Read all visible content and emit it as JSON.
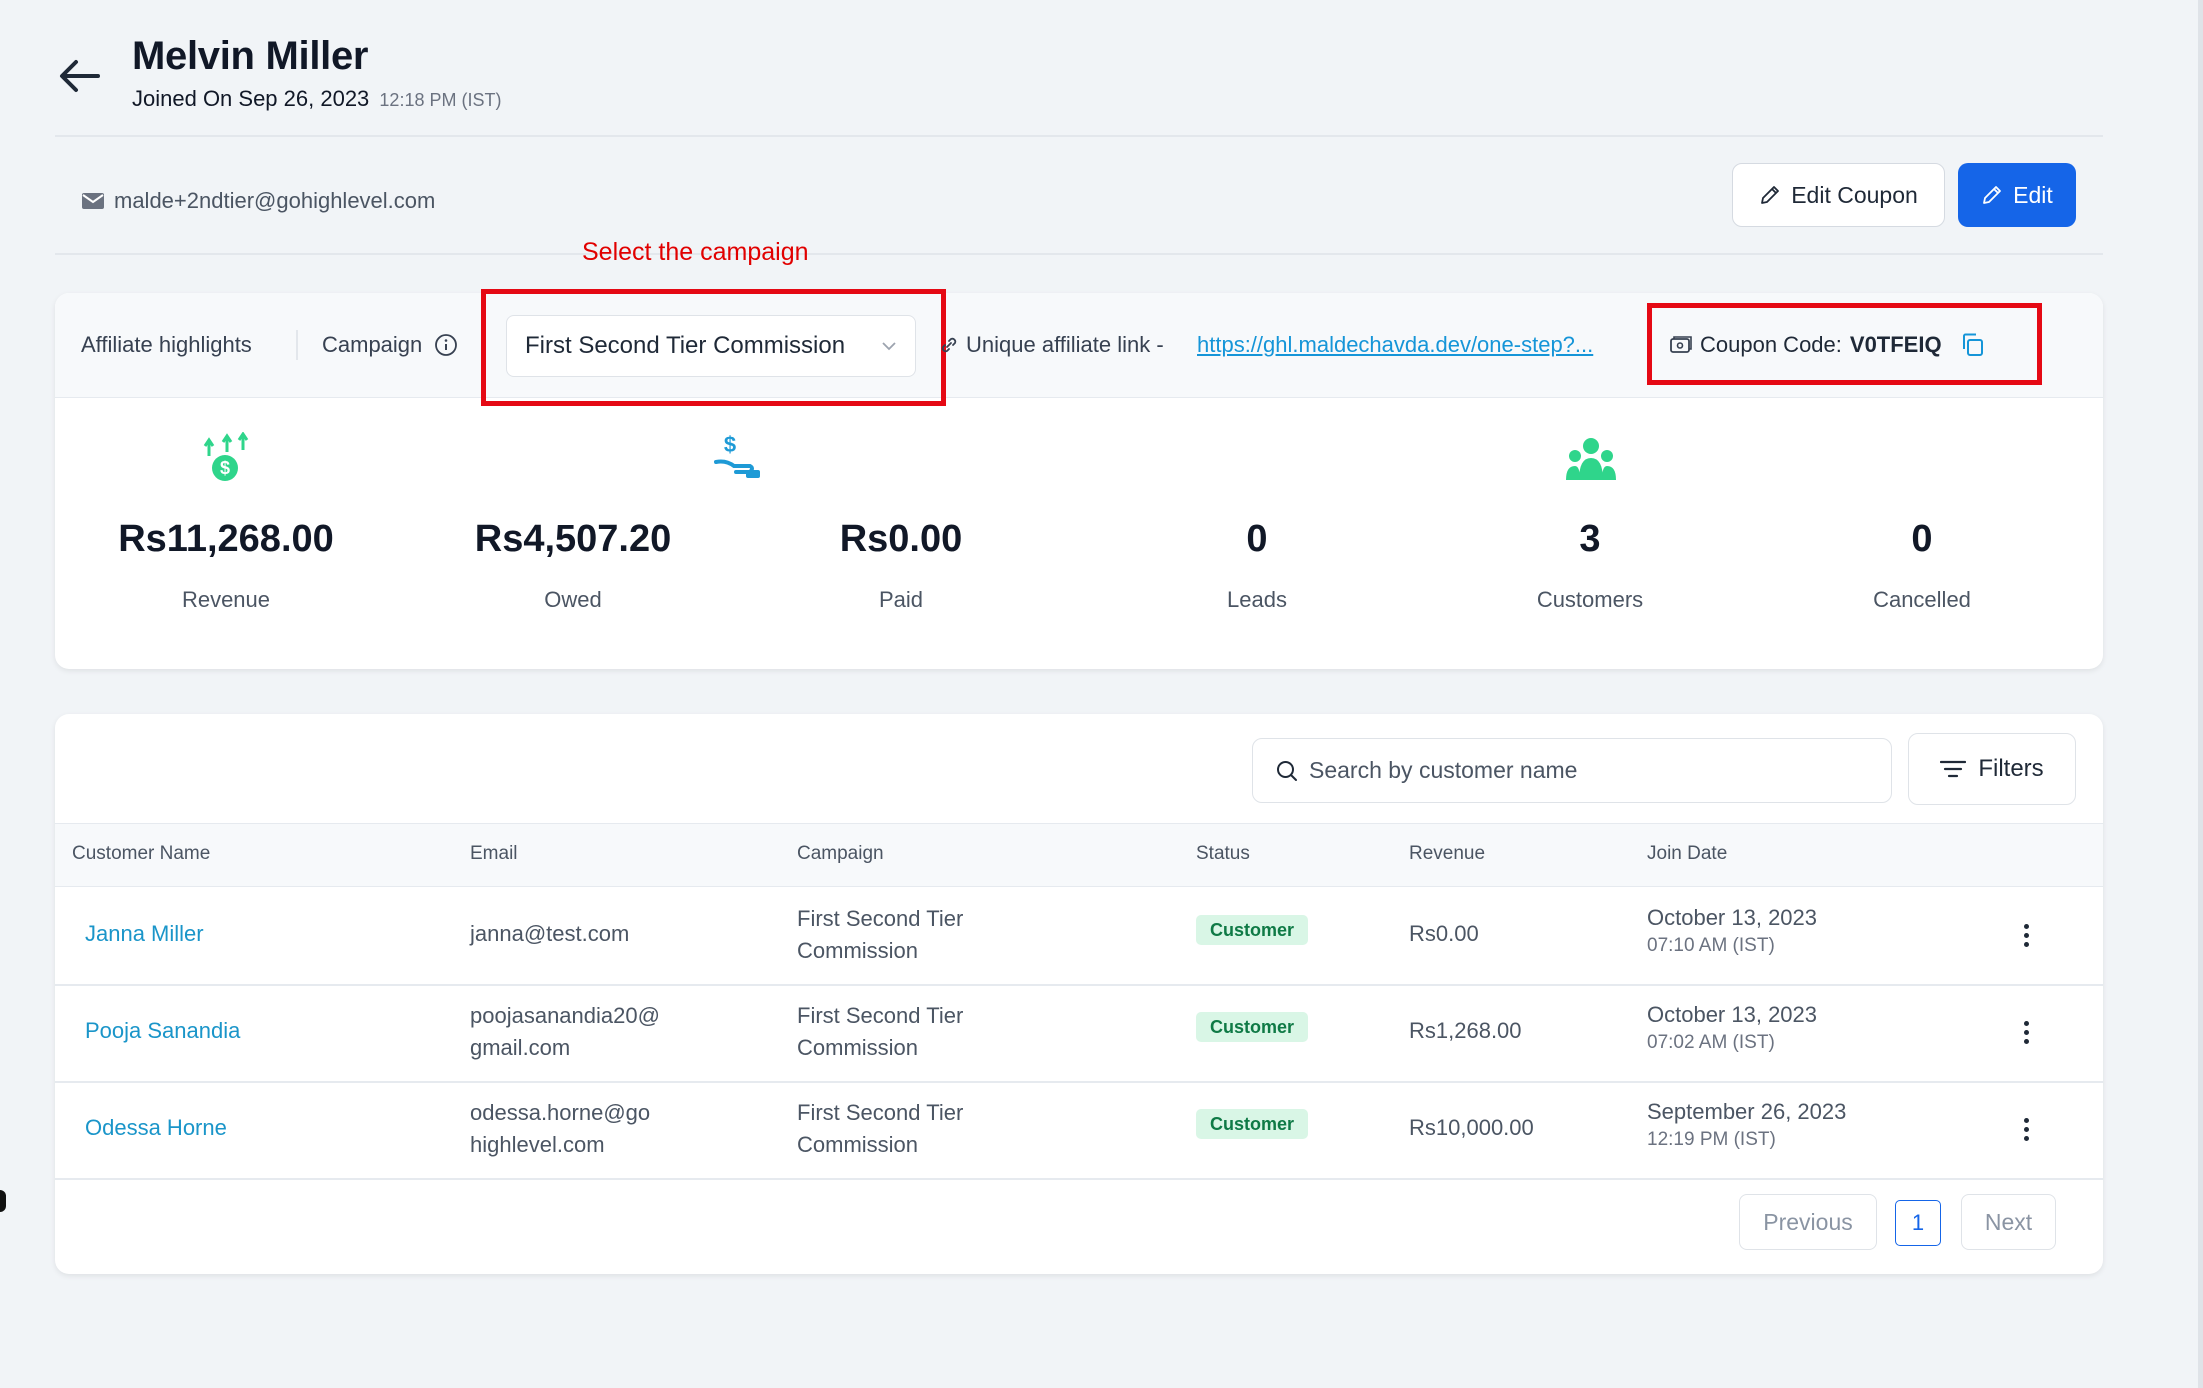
{
  "header": {
    "name": "Melvin Miller",
    "joined_label": "Joined On Sep 26, 2023",
    "joined_time": "12:18 PM (IST)"
  },
  "contact": {
    "email": "malde+2ndtier@gohighlevel.com"
  },
  "actions": {
    "edit_coupon_label": "Edit Coupon",
    "edit_label": "Edit",
    "primary_color": "#1565e8"
  },
  "annotation": {
    "text": "Select the campaign",
    "color": "#e50914"
  },
  "highlights": {
    "title": "Affiliate highlights",
    "campaign_label": "Campaign",
    "campaign_selected": "First Second Tier Commission",
    "link_label": "Unique affiliate link -",
    "link_url": "https://ghl.maldechavda.dev/one-step?...",
    "coupon_label": "Coupon Code:",
    "coupon_code": "V0TFEIQ",
    "stats": [
      {
        "value": "Rs11,268.00",
        "label": "Revenue",
        "icon": "revenue-icon"
      },
      {
        "value": "Rs4,507.20",
        "label": "Owed",
        "icon": "owed-icon"
      },
      {
        "value": "Rs0.00",
        "label": "Paid"
      },
      {
        "value": "0",
        "label": "Leads"
      },
      {
        "value": "3",
        "label": "Customers",
        "icon": "customers-icon"
      },
      {
        "value": "0",
        "label": "Cancelled"
      }
    ],
    "icon_color": "#2fd58b"
  },
  "table": {
    "search_placeholder": "Search by customer name",
    "filters_label": "Filters",
    "columns": [
      "Customer Name",
      "Email",
      "Campaign",
      "Status",
      "Revenue",
      "Join Date"
    ],
    "rows": [
      {
        "name": "Janna Miller",
        "email_1": "janna@test.com",
        "email_2": "",
        "campaign_1": "First Second Tier",
        "campaign_2": "Commission",
        "status": "Customer",
        "revenue": "Rs0.00",
        "date": "October 13, 2023",
        "time": "07:10 AM (IST)"
      },
      {
        "name": "Pooja Sanandia",
        "email_1": "poojasanandia20@",
        "email_2": "gmail.com",
        "campaign_1": "First Second Tier",
        "campaign_2": "Commission",
        "status": "Customer",
        "revenue": "Rs1,268.00",
        "date": "October 13, 2023",
        "time": "07:02 AM (IST)"
      },
      {
        "name": "Odessa Horne",
        "email_1": "odessa.horne@go",
        "email_2": "highlevel.com",
        "campaign_1": "First Second Tier",
        "campaign_2": "Commission",
        "status": "Customer",
        "revenue": "Rs10,000.00",
        "date": "September 26, 2023",
        "time": "12:19 PM (IST)"
      }
    ]
  },
  "pagination": {
    "previous": "Previous",
    "current": "1",
    "next": "Next"
  }
}
